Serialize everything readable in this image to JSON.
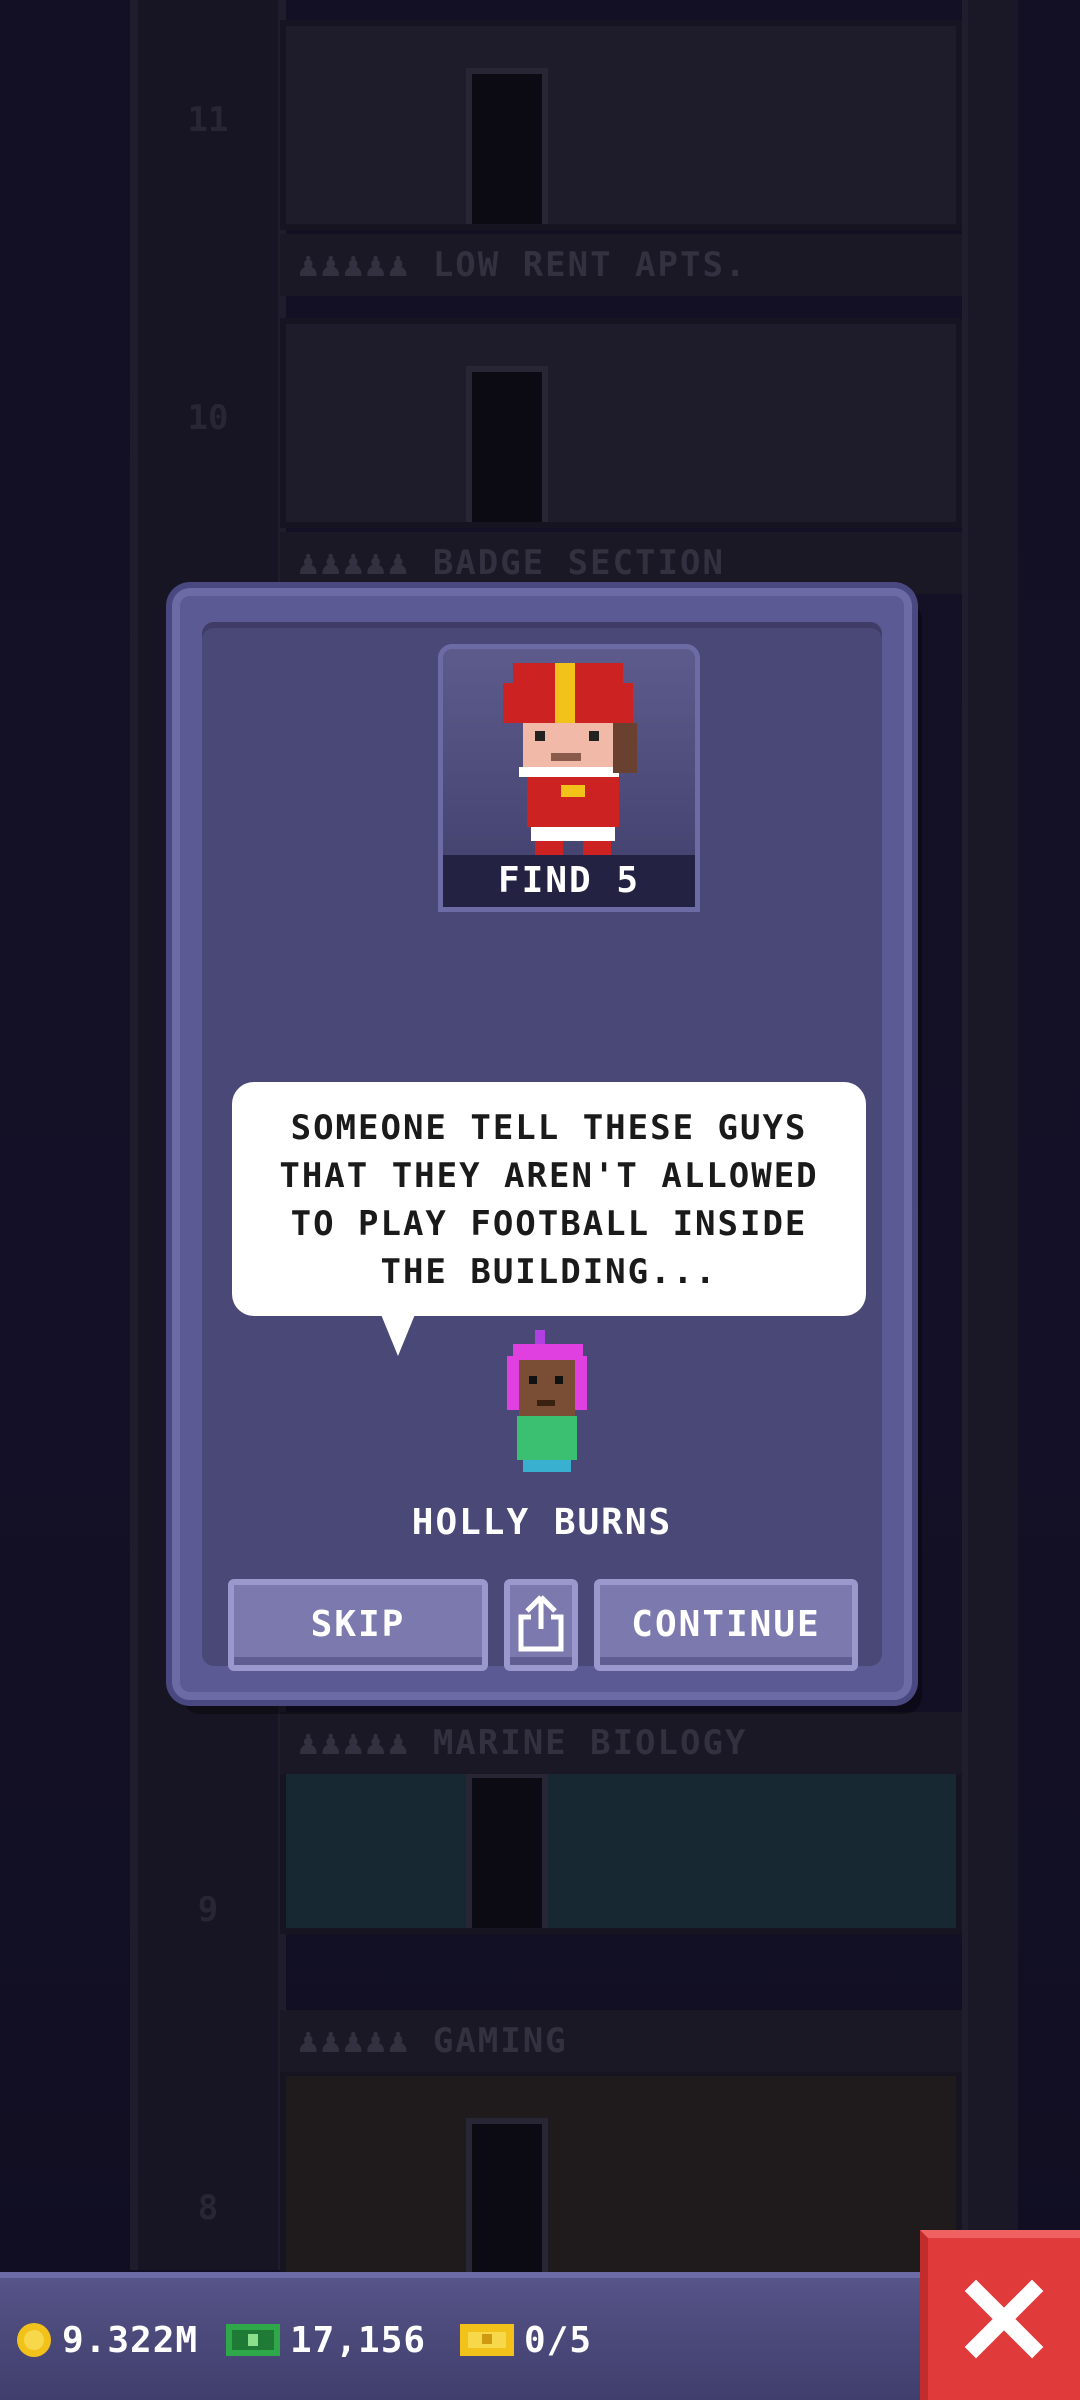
{
  "background": {
    "floors": [
      {
        "number": "11",
        "label": "♟♟♟♟♟ LOW RENT APTS."
      },
      {
        "number": "10",
        "label": "♟♟♟♟♟ BADGE SECTION"
      },
      {
        "number": "9",
        "label": "♟♟♟♟♟ MARINE BIOLOGY"
      },
      {
        "number": "8",
        "label": "♟♟♟♟♟ GAMING"
      }
    ]
  },
  "mission": {
    "find_label": "FIND 5",
    "icon": "football-player-icon"
  },
  "dialog": {
    "speech_lines": [
      "SOMEONE TELL THESE GUYS",
      "THAT THEY AREN'T ALLOWED",
      "TO PLAY FOOTBALL INSIDE",
      "THE BUILDING..."
    ],
    "speaker_name": "HOLLY BURNS",
    "skip_label": "SKIP",
    "continue_label": "CONTINUE",
    "share_icon": "share-icon"
  },
  "status_bar": {
    "coins": "9.322M",
    "bux": "17,156",
    "tickets": "0/5",
    "coin_icon": "coin-icon",
    "bux_icon": "cash-icon",
    "ticket_icon": "ticket-icon"
  },
  "colors": {
    "dialog_bg": "#4a4876",
    "button": "#7b79ae",
    "close": "#e03a3a"
  }
}
